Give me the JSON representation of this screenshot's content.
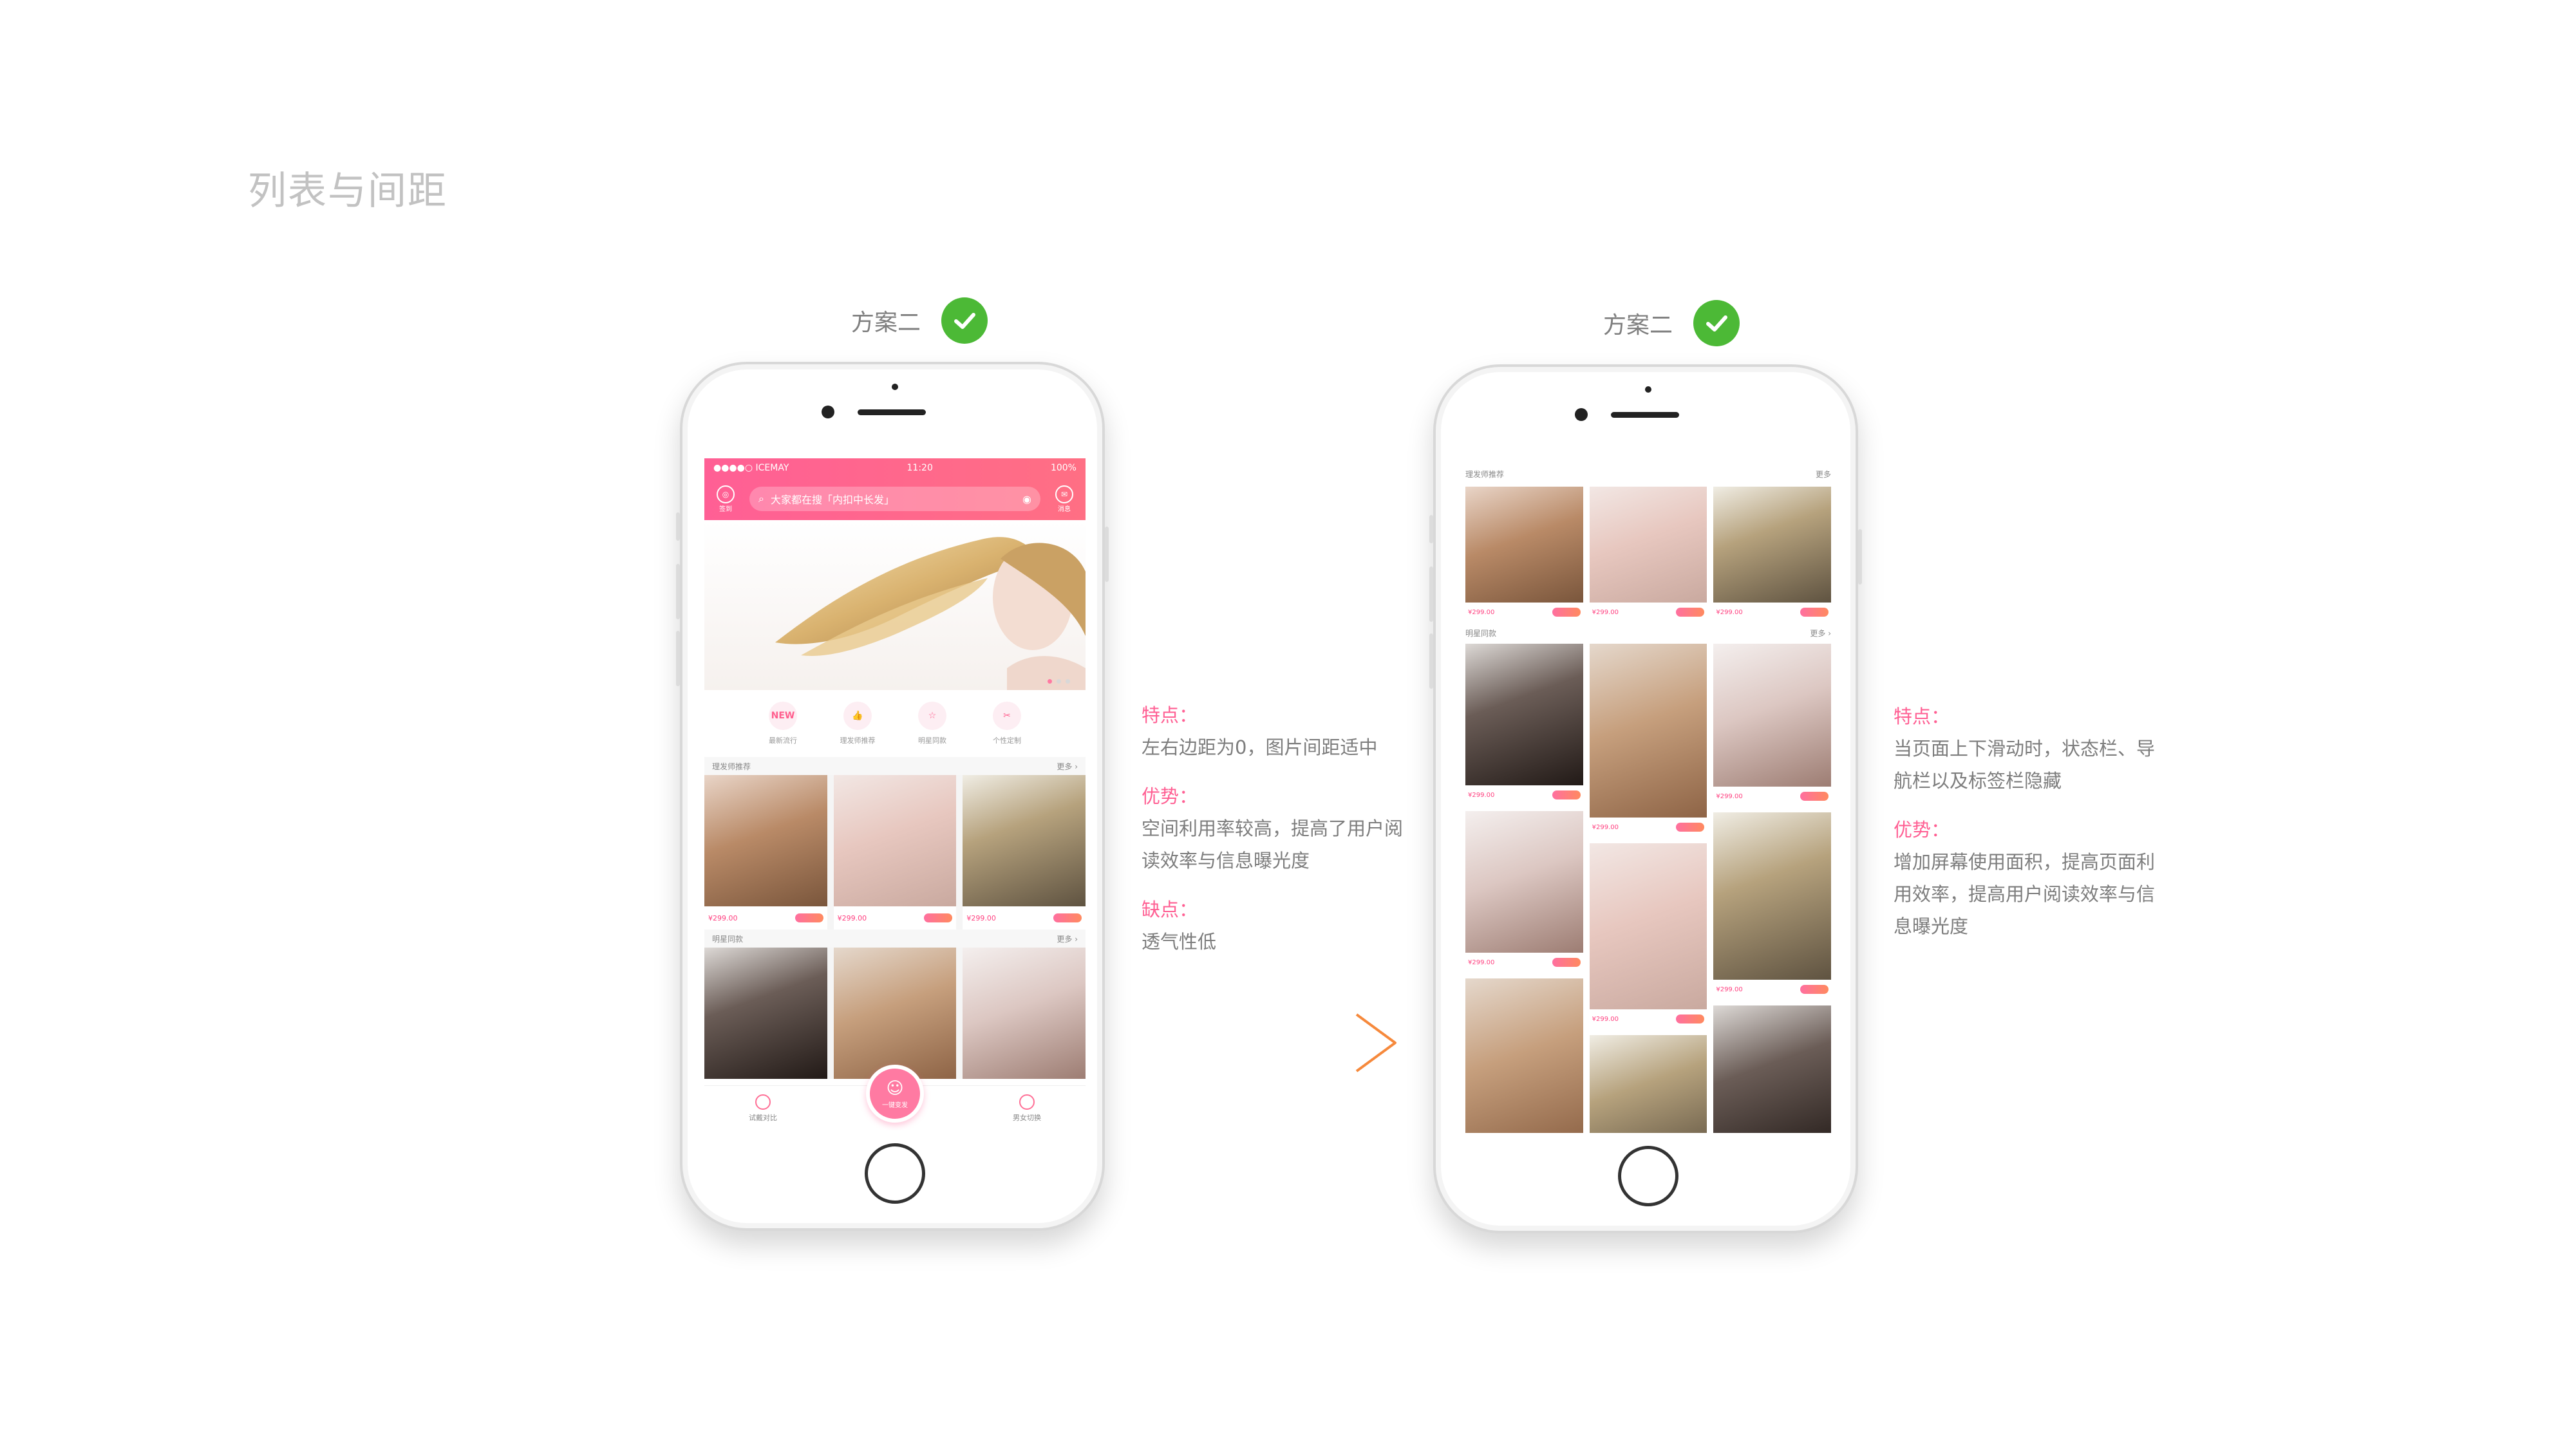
{
  "page_title": "列表与间距",
  "left_plan": {
    "label": "方案二"
  },
  "right_plan": {
    "label": "方案二"
  },
  "status_bar": {
    "carrier": "●●●●○ ICEMAY",
    "time": "11:20",
    "battery": "100%"
  },
  "nav": {
    "left_icon_label": "签到",
    "search_placeholder": "大家都在搜「内扣中长发」",
    "right_icon_label": "消息"
  },
  "categories": [
    {
      "icon_text": "NEW",
      "label": "最新流行"
    },
    {
      "icon_text": "👍",
      "label": "理发师推荐"
    },
    {
      "icon_text": "☆",
      "label": "明星同款"
    },
    {
      "icon_text": "✂",
      "label": "个性定制"
    }
  ],
  "section1": {
    "title": "理发师推荐",
    "more": "更多 ›"
  },
  "section2": {
    "title": "明星同款",
    "more": "更多 ›"
  },
  "price": "¥299.00",
  "tabs": {
    "left": "试戴对比",
    "center": "一键变发",
    "right": "男女切换"
  },
  "right_screen": {
    "section1_title": "理发师推荐",
    "section1_more": "更多",
    "section2_title": "明星同款",
    "section2_more": "更多 ›"
  },
  "left_notes": {
    "features_title": "特点：",
    "features_text": "左右边距为0，图片间距适中",
    "advantage_title": "优势：",
    "advantage_text_1": "空间利用率较高，提高了用户阅",
    "advantage_text_2": "读效率与信息曝光度",
    "disadvantage_title": "缺点：",
    "disadvantage_text": "透气性低"
  },
  "right_notes": {
    "features_title": "特点：",
    "features_text_1": "当页面上下滑动时，状态栏、导",
    "features_text_2": "航栏以及标签栏隐藏",
    "advantage_title": "优势：",
    "advantage_text_1": "增加屏幕使用面积，提高页面利",
    "advantage_text_2": "用效率，提高用户阅读效率与信",
    "advantage_text_3": "息曝光度"
  },
  "colors": {
    "brand_pink": "#ff5f95",
    "check_green": "#4cb936",
    "arrow_orange": "#f6893c"
  }
}
